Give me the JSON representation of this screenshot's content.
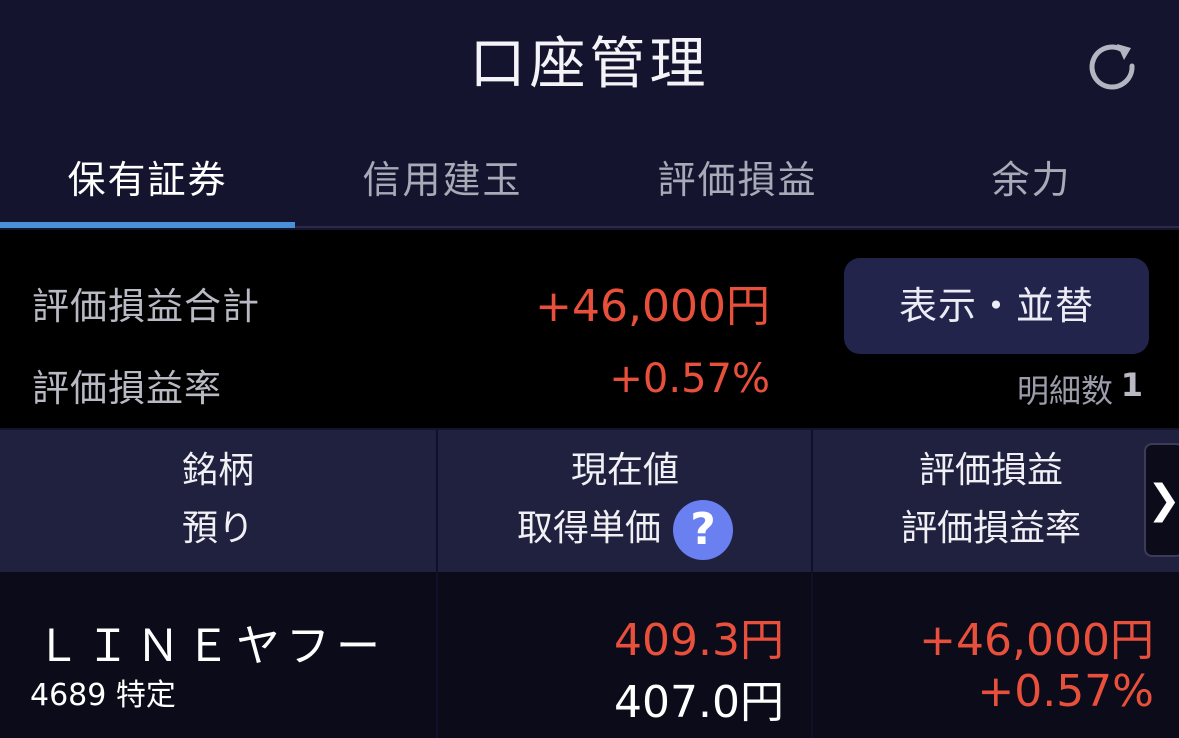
{
  "header": {
    "title": "口座管理",
    "refresh_icon": "refresh-icon"
  },
  "tabs": [
    {
      "label": "保有証券",
      "active": true
    },
    {
      "label": "信用建玉",
      "active": false
    },
    {
      "label": "評価損益",
      "active": false
    },
    {
      "label": "余力",
      "active": false
    }
  ],
  "summary": {
    "total_label": "評価損益合計",
    "total_value": "+46,000円",
    "rate_label": "評価損益率",
    "rate_value": "+0.57%",
    "display_button": "表示・並替",
    "count_label": "明細数",
    "count_value": "1"
  },
  "columns": {
    "col1_line1": "銘柄",
    "col1_line2": "預り",
    "col2_line1": "現在値",
    "col2_line2": "取得単価",
    "col3_line1": "評価損益",
    "col3_line2": "評価損益率",
    "help_icon": "?",
    "next_arrow": "❯"
  },
  "holdings": [
    {
      "name": "ＬＩＮＥヤフー",
      "code": "4689 特定",
      "current_price": "409.3円",
      "acquisition_price": "407.0円",
      "gain": "+46,000円",
      "gain_rate": "+0.57%"
    }
  ],
  "colors": {
    "positive": "#e9503c",
    "accent": "#4a90d9",
    "help": "#6a7ff0"
  }
}
